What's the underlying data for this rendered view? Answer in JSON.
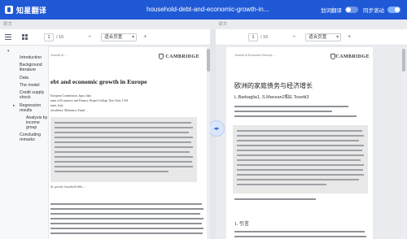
{
  "app": {
    "name": "知星翻译",
    "doc_title": "household-debt-and-economic-growth-in...",
    "toggles": [
      {
        "label": "划词翻译",
        "on": false
      },
      {
        "label": "同步滚动",
        "on": true
      }
    ]
  },
  "panes": {
    "left_label": "原文",
    "right_label": "译文"
  },
  "toolbar": {
    "page_current": "1",
    "page_total": "/ 16",
    "zoom": "适合页宽"
  },
  "outline": {
    "items": [
      "Introduction",
      "Background literature",
      "Data",
      "The model",
      "Credit supply shock",
      "Regression results",
      "Analysis by income group",
      "Concluding remarks"
    ]
  },
  "left_doc": {
    "id": "Journal of ...",
    "publisher": "CAMBRIDGE",
    "title": "ebt and economic growth in Europe",
    "affiliations": [
      "European Commission, Ispra, Italy",
      "ment of Economics and Finance, Brunel College, New York, USA",
      "ment, Italy",
      "ail address: Malmonsi, Email: ..."
    ],
    "keywords": "ds: growth, household debt, ..."
  },
  "right_doc": {
    "id": "Journal of Economic Surveys ...",
    "publisher": "CAMBRIDGE",
    "title": "欧洲的家庭债务与经济增长",
    "authors": "L.Barbaglia1, S.Manzan2和E.Tosetti3",
    "intro_heading": "1. 引言"
  },
  "colors": {
    "brand": "#1f59d6",
    "accent": "#7fb0ff"
  }
}
